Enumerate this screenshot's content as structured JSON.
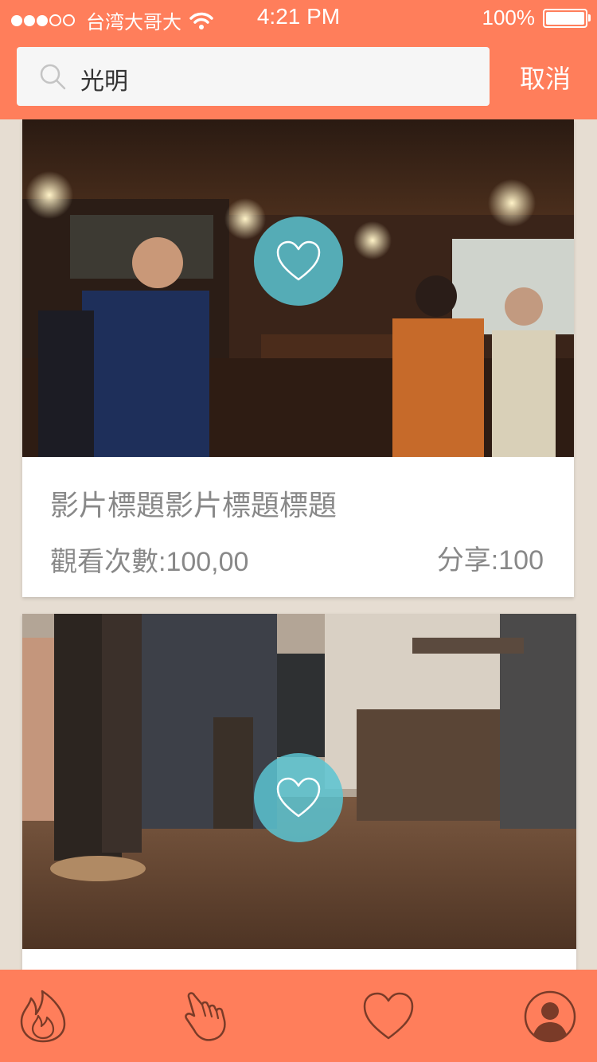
{
  "status_bar": {
    "carrier": "台湾大哥大",
    "time": "4:21 PM",
    "battery": "100%"
  },
  "search": {
    "query": "光明",
    "cancel_label": "取消"
  },
  "cards": [
    {
      "title": "影片標題影片標題標題",
      "views": "觀看次數:100,00",
      "shares": "分享:100"
    }
  ],
  "tabbar": {
    "items": [
      "fire-icon",
      "hand-pointer-icon",
      "heart-icon",
      "profile-icon"
    ]
  },
  "colors": {
    "accent": "#ff7e5b",
    "like_button": "#5bc4d2",
    "background": "#e6ddd2"
  }
}
